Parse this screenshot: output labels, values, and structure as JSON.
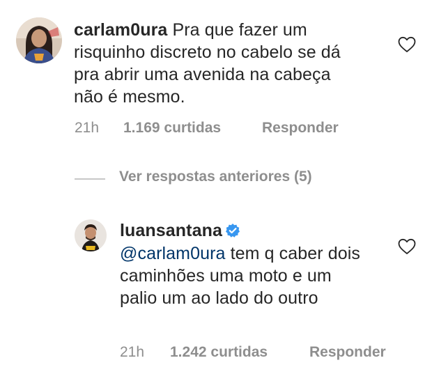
{
  "comment": {
    "username": "carlam0ura",
    "text": " Pra que fazer um risquinho discreto no cabelo se dá pra abrir uma avenida na cabeça não é mesmo.",
    "time": "21h",
    "likes": "1.169 curtidas",
    "reply_label": "Responder",
    "avatar_icon": "user-avatar-photo",
    "like_icon": "heart-outline-icon"
  },
  "replies_toggle": {
    "label": "Ver respostas anteriores (5)"
  },
  "reply": {
    "username": "luansantana",
    "verified_icon": "verified-badge-icon",
    "mention": "@carlam0ura",
    "text": " tem q caber dois caminhões uma moto e um palio um ao lado do outro",
    "time": "21h",
    "likes": "1.242 curtidas",
    "reply_label": "Responder",
    "avatar_icon": "user-avatar-photo",
    "like_icon": "heart-outline-icon"
  },
  "colors": {
    "text": "#262626",
    "muted": "#8e8e8e",
    "mention": "#003569",
    "verified": "#3897f0"
  }
}
